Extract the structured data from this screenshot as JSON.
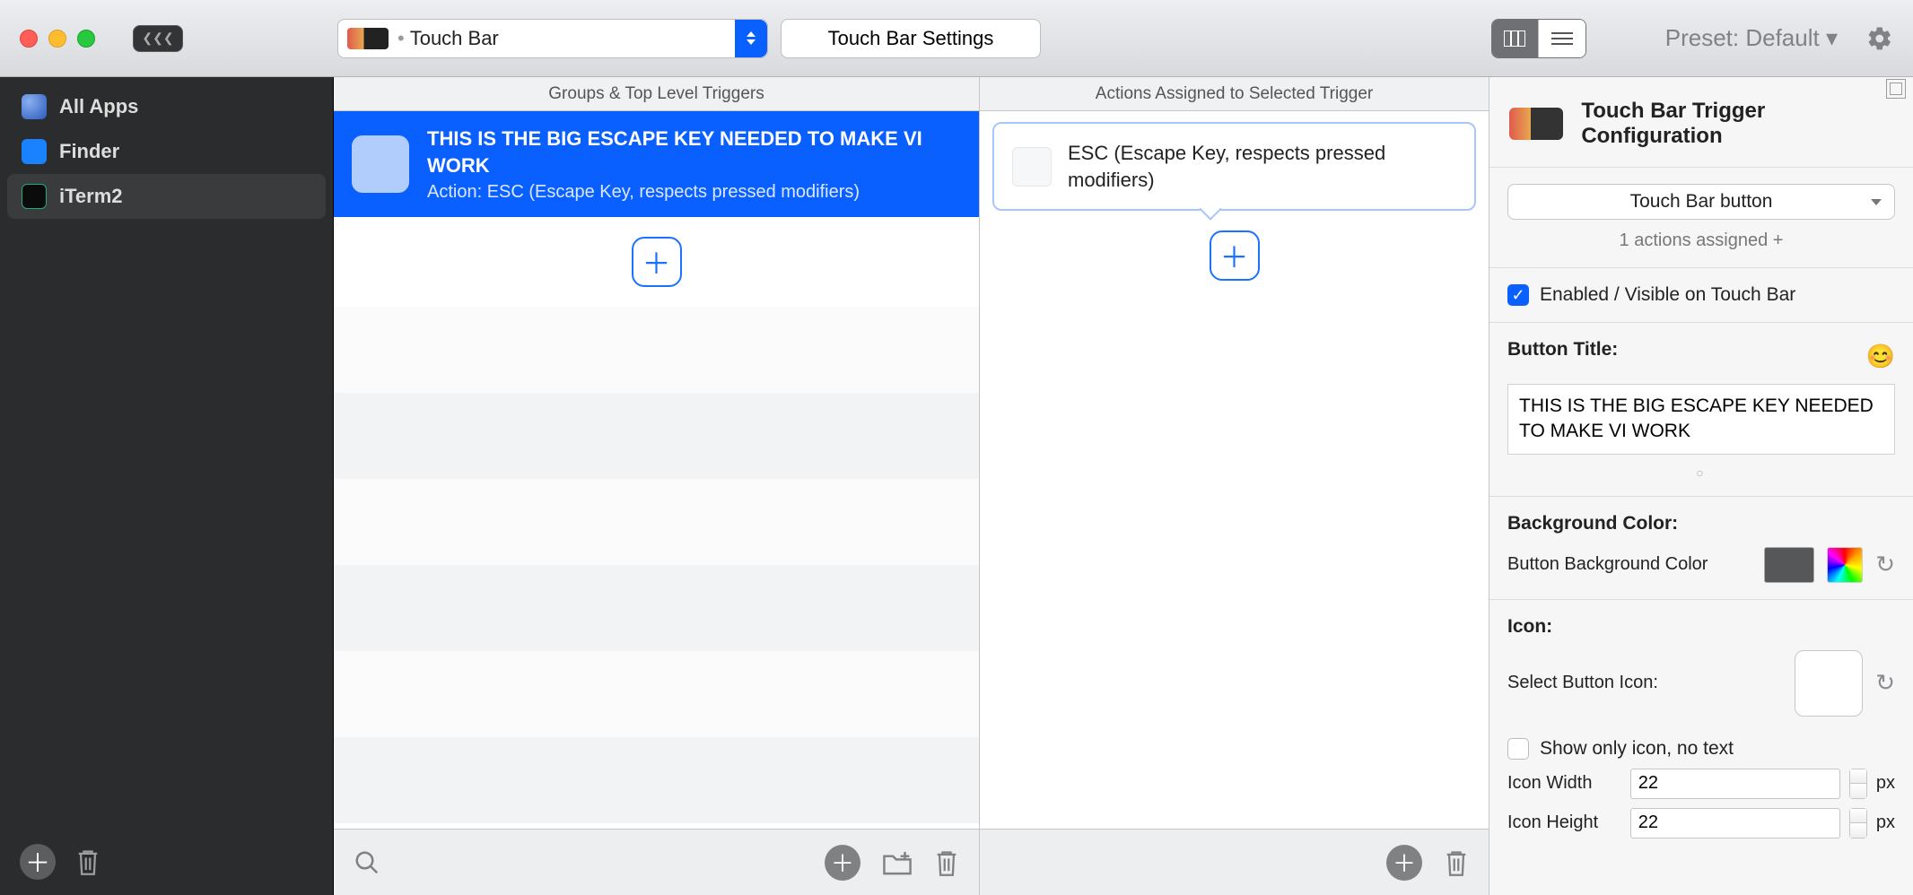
{
  "toolbar": {
    "trigger_type": "Touch Bar",
    "settings_button": "Touch Bar Settings",
    "preset_label": "Preset: Default ▾"
  },
  "sidebar": {
    "items": [
      {
        "label": "All Apps",
        "icon": "globe",
        "color": "#4a7bd3"
      },
      {
        "label": "Finder",
        "icon": "finder",
        "color": "#1a82ff"
      },
      {
        "label": "iTerm2",
        "icon": "iterm",
        "color": "#111",
        "selected": true
      }
    ]
  },
  "columns": {
    "triggers_header": "Groups & Top Level Triggers",
    "actions_header": "Actions Assigned to Selected Trigger"
  },
  "triggers": [
    {
      "title": "THIS IS THE BIG ESCAPE KEY NEEDED TO MAKE VI WORK",
      "subtitle": "Action: ESC (Escape Key, respects pressed modifiers)",
      "selected": true
    }
  ],
  "actions": [
    {
      "title": "ESC (Escape Key, respects pressed modifiers)"
    }
  ],
  "config": {
    "panel_title": "Touch Bar Trigger Configuration",
    "trigger_kind": "Touch Bar button",
    "actions_assigned": "1 actions assigned +",
    "enabled_label": "Enabled / Visible on Touch Bar",
    "enabled": true,
    "button_title_label": "Button Title:",
    "button_title": "THIS IS THE BIG ESCAPE KEY NEEDED TO MAKE VI WORK",
    "bg_section": "Background Color:",
    "bg_label": "Button Background Color",
    "icon_section": "Icon:",
    "select_icon_label": "Select Button Icon:",
    "show_only_icon_label": "Show only icon, no text",
    "show_only_icon": false,
    "icon_width_label": "Icon Width",
    "icon_width": "22",
    "icon_height_label": "Icon Height",
    "icon_height": "22",
    "px": "px"
  }
}
